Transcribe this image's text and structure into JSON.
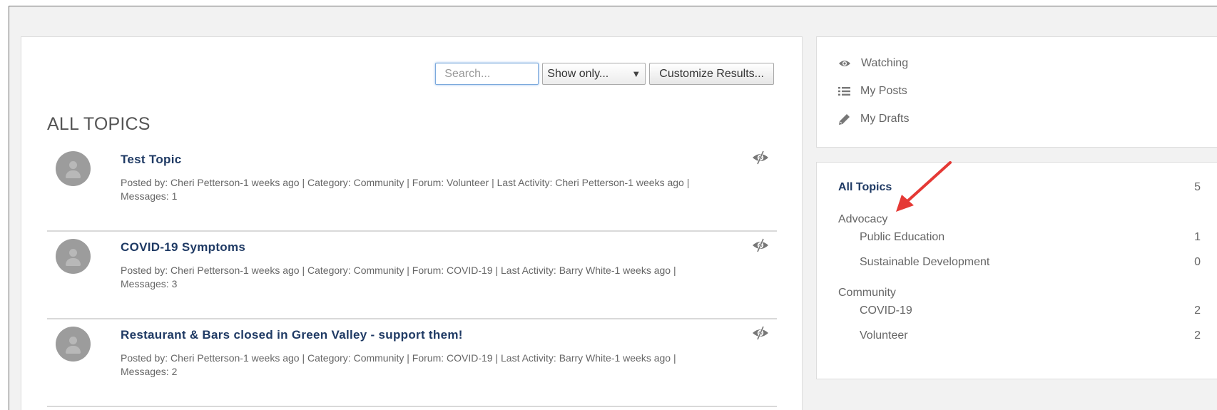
{
  "toolbar": {
    "search_placeholder": "Search...",
    "show_only_label": "Show only...",
    "customize_label": "Customize Results..."
  },
  "main": {
    "title": "ALL TOPICS",
    "topics": [
      {
        "title": "Test Topic",
        "meta": "Posted by: Cheri Petterson-1 weeks ago | Category: Community | Forum: Volunteer | Last Activity: Cheri Petterson-1 weeks ago | Messages: 1"
      },
      {
        "title": "COVID-19 Symptoms",
        "meta": "Posted by: Cheri Petterson-1 weeks ago | Category: Community | Forum: COVID-19 | Last Activity: Barry White-1 weeks ago | Messages: 3"
      },
      {
        "title": "Restaurant & Bars closed in Green Valley - support them!",
        "meta": "Posted by: Cheri Petterson-1 weeks ago | Category: Community | Forum: COVID-19 | Last Activity: Barry White-1 weeks ago | Messages: 2"
      }
    ]
  },
  "sidebar": {
    "links": [
      {
        "label": "Watching",
        "icon": "eye-icon"
      },
      {
        "label": "My Posts",
        "icon": "list-icon"
      },
      {
        "label": "My Drafts",
        "icon": "pencil-icon"
      }
    ],
    "categories": {
      "all": {
        "label": "All Topics",
        "count": "5"
      },
      "groups": [
        {
          "name": "Advocacy",
          "forums": [
            {
              "label": "Public Education",
              "count": "1"
            },
            {
              "label": "Sustainable Development",
              "count": "0"
            }
          ]
        },
        {
          "name": "Community",
          "forums": [
            {
              "label": "COVID-19",
              "count": "2"
            },
            {
              "label": "Volunteer",
              "count": "2"
            }
          ]
        }
      ]
    }
  },
  "colors": {
    "title_blue": "#1f3a64",
    "annotation_red": "#e53935",
    "avatar_gray": "#9c9c9c"
  }
}
